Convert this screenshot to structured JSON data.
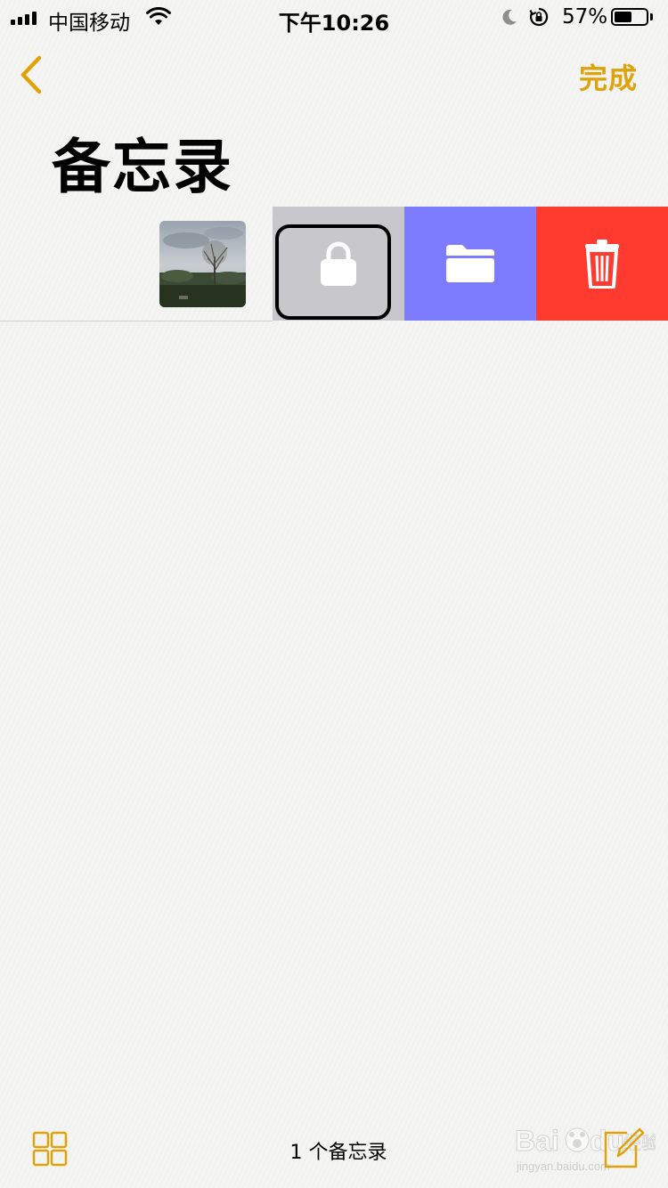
{
  "status_bar": {
    "carrier": "中国移动",
    "time": "下午10:26",
    "battery_percent": "57%",
    "battery_level": 0.57
  },
  "nav": {
    "back_icon": "chevron-left-icon",
    "done_label": "完成"
  },
  "title": "备忘录",
  "note_row": {
    "thumbnail": "tree-photo",
    "actions": [
      {
        "name": "lock",
        "icon": "lock-icon",
        "color": "#c8c7cc"
      },
      {
        "name": "move",
        "icon": "folder-icon",
        "color": "#7d7cff"
      },
      {
        "name": "delete",
        "icon": "trash-icon",
        "color": "#ff3b30"
      }
    ]
  },
  "toolbar": {
    "grid_icon": "grid-icon",
    "note_count": "1 个备忘录",
    "compose_icon": "compose-icon"
  },
  "watermark": {
    "brand": "Baidu经验",
    "url": "jingyan.baidu.com"
  },
  "colors": {
    "accent": "#e0a20a",
    "lock": "#c8c7cc",
    "move": "#7d7cff",
    "delete": "#ff3b30"
  }
}
